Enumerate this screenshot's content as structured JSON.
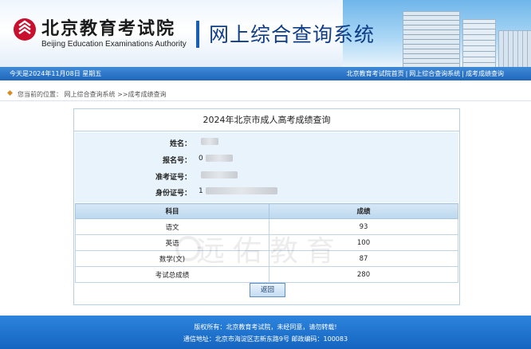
{
  "header": {
    "logo_cn": "北京教育考试院",
    "logo_en": "Beijing Education Examinations Authority",
    "system_title": "网上综合查询系统"
  },
  "navbar": {
    "date": "今天是2024年11月08日 星期五",
    "links": [
      "北京教育考试院首页",
      "网上综合查询系统",
      "成考成绩查询"
    ]
  },
  "breadcrumb": {
    "prefix": "您当前的位置：",
    "path": "网上综合查询系统 >>成考成绩查询"
  },
  "panel": {
    "title": "2024年北京市成人高考成绩查询",
    "fields": [
      {
        "label": "姓名：",
        "value": ""
      },
      {
        "label": "报名号：",
        "value": "0"
      },
      {
        "label": "准考证号：",
        "value": ""
      },
      {
        "label": "身份证号：",
        "value": "1"
      }
    ],
    "table": {
      "headers": [
        "科目",
        "成绩"
      ],
      "rows": [
        {
          "subject": "语文",
          "score": "93"
        },
        {
          "subject": "英语",
          "score": "100"
        },
        {
          "subject": "数学(文)",
          "score": "87"
        },
        {
          "subject": "考试总成绩",
          "score": "280"
        }
      ]
    },
    "back_label": "返回",
    "watermark": "远佑教育"
  },
  "footer": {
    "line1": "版权所有：北京教育考试院，未经同意，请勿转载!",
    "line2": "通信地址：北京市海淀区志新东路9号 邮政编码：100083"
  },
  "colors": {
    "nav_blue": "#1f67bb",
    "title_blue": "#0e3d86",
    "panel_border": "#b9d0e4",
    "info_bg": "#e8f3fb"
  }
}
